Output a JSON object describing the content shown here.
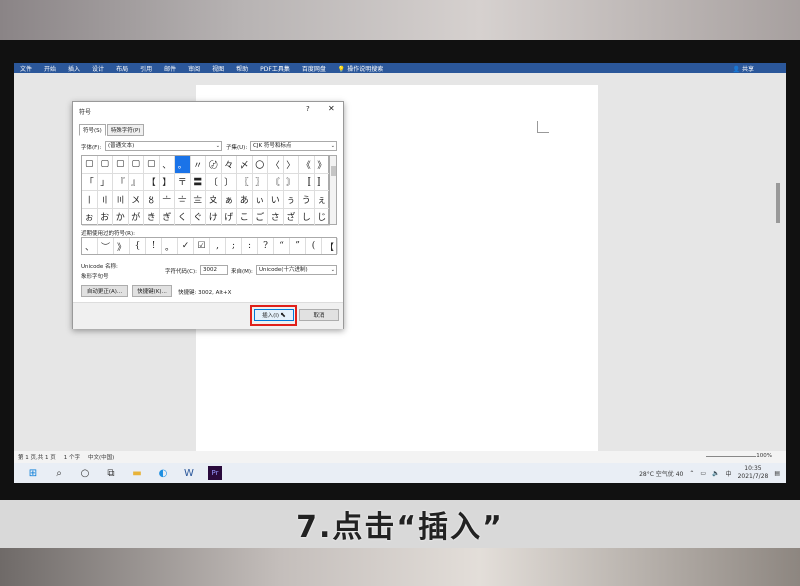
{
  "ribbon": {
    "tabs": [
      "文件",
      "开始",
      "插入",
      "设计",
      "布局",
      "引用",
      "邮件",
      "审阅",
      "视图",
      "帮助",
      "PDF工具集",
      "百度网盘"
    ],
    "search": "操作说明搜索",
    "share": "共享"
  },
  "dialog": {
    "title": "符号",
    "help": "?",
    "close": "✕",
    "tabs": [
      "符号(S)",
      "特殊字符(P)"
    ],
    "font_label": "字体(F):",
    "font_value": "(普通文本)",
    "subset_label": "子集(U):",
    "subset_value": "CJK 符号和标点",
    "symbols": [
      "▢",
      "▢",
      "▢",
      "▢",
      "▢",
      "、",
      "。",
      "〃",
      "〄",
      "々",
      "〆",
      "〇",
      "〈",
      "〉",
      "《",
      "》",
      "「",
      "」",
      "『",
      "』",
      "【",
      "】",
      "〒",
      "〓",
      "〔",
      "〕",
      "〖",
      "〗",
      "〘",
      "〙",
      "〚",
      "〛",
      "〡",
      "〢",
      "〣",
      "〤",
      "〥",
      "〦",
      "〧",
      "〨",
      "〩",
      "ぁ",
      "あ",
      "ぃ",
      "い",
      "ぅ",
      "う",
      "ぇ",
      "ぉ",
      "お",
      "か",
      "が",
      "き",
      "ぎ",
      "く",
      "ぐ",
      "け",
      "げ",
      "こ",
      "ご",
      "さ",
      "ざ",
      "し",
      "じ"
    ],
    "selected_index": 6,
    "recent_label": "近期使用过的符号(R):",
    "recent": [
      "、",
      "︶",
      "》",
      "{",
      "!",
      "。",
      "✓",
      "☑",
      ",",
      ";",
      ":",
      "?",
      "“",
      "”",
      "(",
      "【"
    ],
    "unicode_name_label": "Unicode 名称:",
    "unicode_name": "象形字句号",
    "char_code_label": "字符代码(C):",
    "char_code": "3002",
    "from_label": "来自(M):",
    "from_value": "Unicode(十六进制)",
    "autocorrect_button": "自动更正(A)...",
    "shortcut_button": "快捷键(K)...",
    "shortcut_text": "快捷键: 3002, Alt+X",
    "insert_button": "插入(I)",
    "cancel_button": "取消"
  },
  "statusbar": {
    "page": "第 1 页,共 1 页",
    "words": "1 个字",
    "lang": "中文(中国)",
    "zoom": "100%"
  },
  "taskbar": {
    "weather": "28°C 空气优 40",
    "ime": "中",
    "time": "10:35",
    "date": "2021/7/28"
  },
  "caption": "7.点击“插入”",
  "colors": {
    "ribbon": "#2b579a",
    "highlight": "#e0201a",
    "selected": "#1a73e8"
  }
}
